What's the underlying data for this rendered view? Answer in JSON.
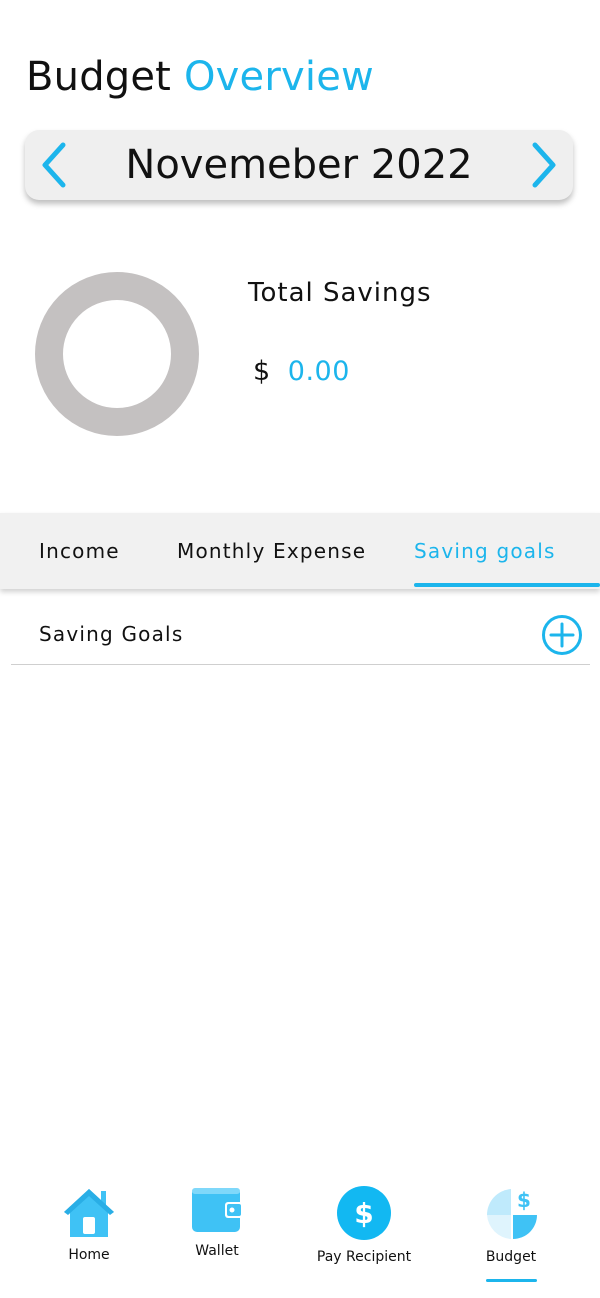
{
  "header": {
    "title_part1": "Budget",
    "title_part2": "Overview"
  },
  "month_selector": {
    "label": "Novemeber 2022"
  },
  "savings": {
    "label": "Total Savings",
    "currency": "$",
    "amount": "0.00"
  },
  "tabs": {
    "income": "Income",
    "monthly_expense": "Monthly Expense",
    "saving_goals": "Saving goals",
    "active": "saving_goals"
  },
  "goals_section": {
    "label": "Saving Goals"
  },
  "bottom_nav": {
    "home": "Home",
    "wallet": "Wallet",
    "pay_recipient": "Pay Recipient",
    "budget": "Budget",
    "active": "budget"
  },
  "colors": {
    "accent": "#1cb5ec",
    "donut_ring": "#c4c1c1",
    "tab_bar_bg": "#f1f1f1"
  },
  "icons": {
    "prev": "chevron-left-icon",
    "next": "chevron-right-icon",
    "add": "add-circle-icon",
    "home": "home-icon",
    "wallet": "wallet-icon",
    "pay": "dollar-circle-icon",
    "budget": "pie-chart-dollar-icon"
  }
}
